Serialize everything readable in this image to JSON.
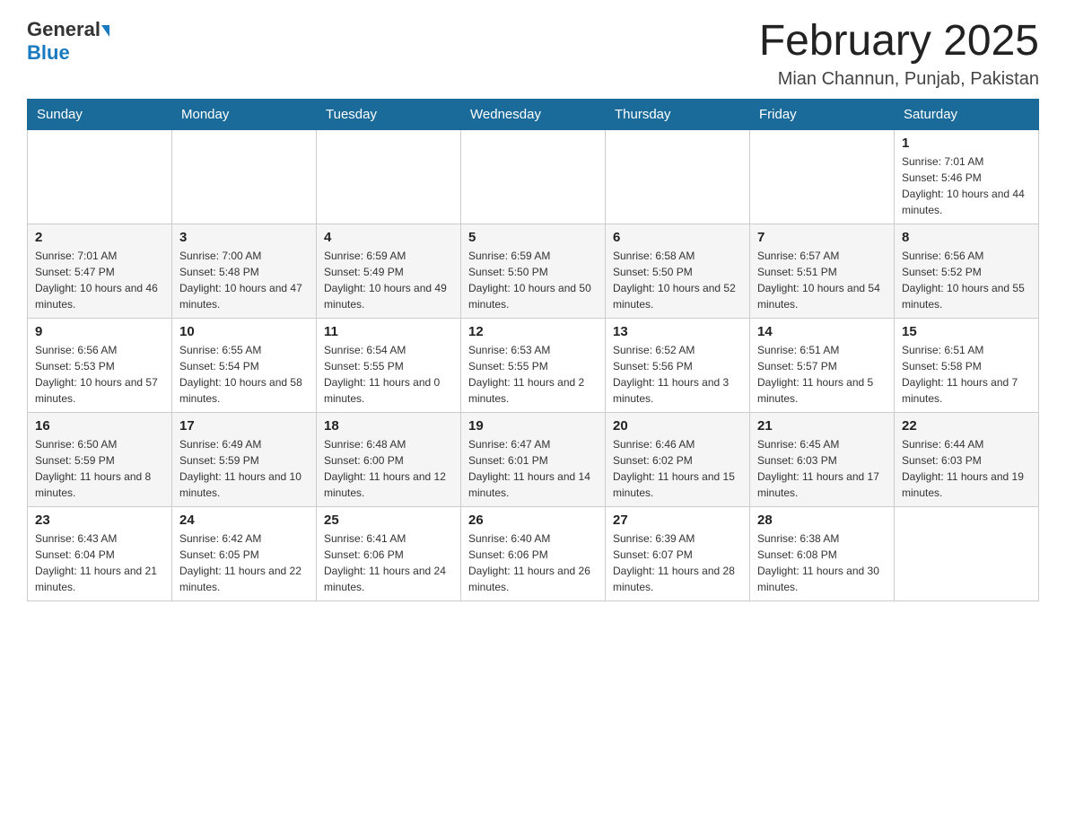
{
  "header": {
    "logo_general": "General",
    "logo_blue": "Blue",
    "month_title": "February 2025",
    "location": "Mian Channun, Punjab, Pakistan"
  },
  "weekdays": [
    "Sunday",
    "Monday",
    "Tuesday",
    "Wednesday",
    "Thursday",
    "Friday",
    "Saturday"
  ],
  "weeks": [
    [
      {
        "day": "",
        "sunrise": "",
        "sunset": "",
        "daylight": ""
      },
      {
        "day": "",
        "sunrise": "",
        "sunset": "",
        "daylight": ""
      },
      {
        "day": "",
        "sunrise": "",
        "sunset": "",
        "daylight": ""
      },
      {
        "day": "",
        "sunrise": "",
        "sunset": "",
        "daylight": ""
      },
      {
        "day": "",
        "sunrise": "",
        "sunset": "",
        "daylight": ""
      },
      {
        "day": "",
        "sunrise": "",
        "sunset": "",
        "daylight": ""
      },
      {
        "day": "1",
        "sunrise": "Sunrise: 7:01 AM",
        "sunset": "Sunset: 5:46 PM",
        "daylight": "Daylight: 10 hours and 44 minutes."
      }
    ],
    [
      {
        "day": "2",
        "sunrise": "Sunrise: 7:01 AM",
        "sunset": "Sunset: 5:47 PM",
        "daylight": "Daylight: 10 hours and 46 minutes."
      },
      {
        "day": "3",
        "sunrise": "Sunrise: 7:00 AM",
        "sunset": "Sunset: 5:48 PM",
        "daylight": "Daylight: 10 hours and 47 minutes."
      },
      {
        "day": "4",
        "sunrise": "Sunrise: 6:59 AM",
        "sunset": "Sunset: 5:49 PM",
        "daylight": "Daylight: 10 hours and 49 minutes."
      },
      {
        "day": "5",
        "sunrise": "Sunrise: 6:59 AM",
        "sunset": "Sunset: 5:50 PM",
        "daylight": "Daylight: 10 hours and 50 minutes."
      },
      {
        "day": "6",
        "sunrise": "Sunrise: 6:58 AM",
        "sunset": "Sunset: 5:50 PM",
        "daylight": "Daylight: 10 hours and 52 minutes."
      },
      {
        "day": "7",
        "sunrise": "Sunrise: 6:57 AM",
        "sunset": "Sunset: 5:51 PM",
        "daylight": "Daylight: 10 hours and 54 minutes."
      },
      {
        "day": "8",
        "sunrise": "Sunrise: 6:56 AM",
        "sunset": "Sunset: 5:52 PM",
        "daylight": "Daylight: 10 hours and 55 minutes."
      }
    ],
    [
      {
        "day": "9",
        "sunrise": "Sunrise: 6:56 AM",
        "sunset": "Sunset: 5:53 PM",
        "daylight": "Daylight: 10 hours and 57 minutes."
      },
      {
        "day": "10",
        "sunrise": "Sunrise: 6:55 AM",
        "sunset": "Sunset: 5:54 PM",
        "daylight": "Daylight: 10 hours and 58 minutes."
      },
      {
        "day": "11",
        "sunrise": "Sunrise: 6:54 AM",
        "sunset": "Sunset: 5:55 PM",
        "daylight": "Daylight: 11 hours and 0 minutes."
      },
      {
        "day": "12",
        "sunrise": "Sunrise: 6:53 AM",
        "sunset": "Sunset: 5:55 PM",
        "daylight": "Daylight: 11 hours and 2 minutes."
      },
      {
        "day": "13",
        "sunrise": "Sunrise: 6:52 AM",
        "sunset": "Sunset: 5:56 PM",
        "daylight": "Daylight: 11 hours and 3 minutes."
      },
      {
        "day": "14",
        "sunrise": "Sunrise: 6:51 AM",
        "sunset": "Sunset: 5:57 PM",
        "daylight": "Daylight: 11 hours and 5 minutes."
      },
      {
        "day": "15",
        "sunrise": "Sunrise: 6:51 AM",
        "sunset": "Sunset: 5:58 PM",
        "daylight": "Daylight: 11 hours and 7 minutes."
      }
    ],
    [
      {
        "day": "16",
        "sunrise": "Sunrise: 6:50 AM",
        "sunset": "Sunset: 5:59 PM",
        "daylight": "Daylight: 11 hours and 8 minutes."
      },
      {
        "day": "17",
        "sunrise": "Sunrise: 6:49 AM",
        "sunset": "Sunset: 5:59 PM",
        "daylight": "Daylight: 11 hours and 10 minutes."
      },
      {
        "day": "18",
        "sunrise": "Sunrise: 6:48 AM",
        "sunset": "Sunset: 6:00 PM",
        "daylight": "Daylight: 11 hours and 12 minutes."
      },
      {
        "day": "19",
        "sunrise": "Sunrise: 6:47 AM",
        "sunset": "Sunset: 6:01 PM",
        "daylight": "Daylight: 11 hours and 14 minutes."
      },
      {
        "day": "20",
        "sunrise": "Sunrise: 6:46 AM",
        "sunset": "Sunset: 6:02 PM",
        "daylight": "Daylight: 11 hours and 15 minutes."
      },
      {
        "day": "21",
        "sunrise": "Sunrise: 6:45 AM",
        "sunset": "Sunset: 6:03 PM",
        "daylight": "Daylight: 11 hours and 17 minutes."
      },
      {
        "day": "22",
        "sunrise": "Sunrise: 6:44 AM",
        "sunset": "Sunset: 6:03 PM",
        "daylight": "Daylight: 11 hours and 19 minutes."
      }
    ],
    [
      {
        "day": "23",
        "sunrise": "Sunrise: 6:43 AM",
        "sunset": "Sunset: 6:04 PM",
        "daylight": "Daylight: 11 hours and 21 minutes."
      },
      {
        "day": "24",
        "sunrise": "Sunrise: 6:42 AM",
        "sunset": "Sunset: 6:05 PM",
        "daylight": "Daylight: 11 hours and 22 minutes."
      },
      {
        "day": "25",
        "sunrise": "Sunrise: 6:41 AM",
        "sunset": "Sunset: 6:06 PM",
        "daylight": "Daylight: 11 hours and 24 minutes."
      },
      {
        "day": "26",
        "sunrise": "Sunrise: 6:40 AM",
        "sunset": "Sunset: 6:06 PM",
        "daylight": "Daylight: 11 hours and 26 minutes."
      },
      {
        "day": "27",
        "sunrise": "Sunrise: 6:39 AM",
        "sunset": "Sunset: 6:07 PM",
        "daylight": "Daylight: 11 hours and 28 minutes."
      },
      {
        "day": "28",
        "sunrise": "Sunrise: 6:38 AM",
        "sunset": "Sunset: 6:08 PM",
        "daylight": "Daylight: 11 hours and 30 minutes."
      },
      {
        "day": "",
        "sunrise": "",
        "sunset": "",
        "daylight": ""
      }
    ]
  ]
}
